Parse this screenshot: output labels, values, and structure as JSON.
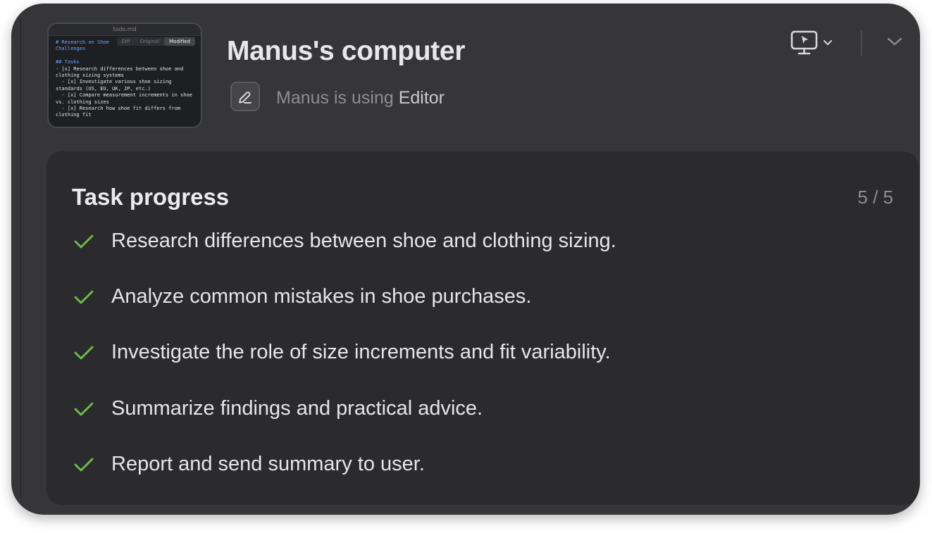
{
  "window": {
    "title": "Manus's computer",
    "subtitle_prefix": "Manus is using",
    "subtitle_tool": "Editor",
    "tool_icon": "pencil-icon"
  },
  "thumbnail": {
    "file_name": "todo.md",
    "tabs": [
      "Diff",
      "Original",
      "Modified"
    ],
    "active_tab": "Modified",
    "lines": [
      "# Research on Shoe",
      "Challenges",
      "",
      "## Tasks",
      "- [x] Research differences between shoe and clothing sizing systems",
      "  - [x] Investigate various shoe sizing standards (US, EU, UK, JP, etc.)",
      "  - [x] Compare measurement increments in shoe vs. clothing sizes",
      "  - [x] Research how shoe fit differs from clothing fit"
    ]
  },
  "controls": {
    "screen_icon": "monitor-cursor-icon",
    "dropdown_icon": "chevron-down-icon",
    "collapse_icon": "chevron-down-icon"
  },
  "progress": {
    "title": "Task progress",
    "count": "5 / 5",
    "check_color": "#6fbf4a",
    "tasks": [
      {
        "label": "Research differences between shoe and clothing sizing.",
        "done": true
      },
      {
        "label": "Analyze common mistakes in shoe purchases.",
        "done": true
      },
      {
        "label": "Investigate the role of size increments and fit variability.",
        "done": true
      },
      {
        "label": "Summarize findings and practical advice.",
        "done": true
      },
      {
        "label": "Report and send summary to user.",
        "done": true
      }
    ]
  }
}
